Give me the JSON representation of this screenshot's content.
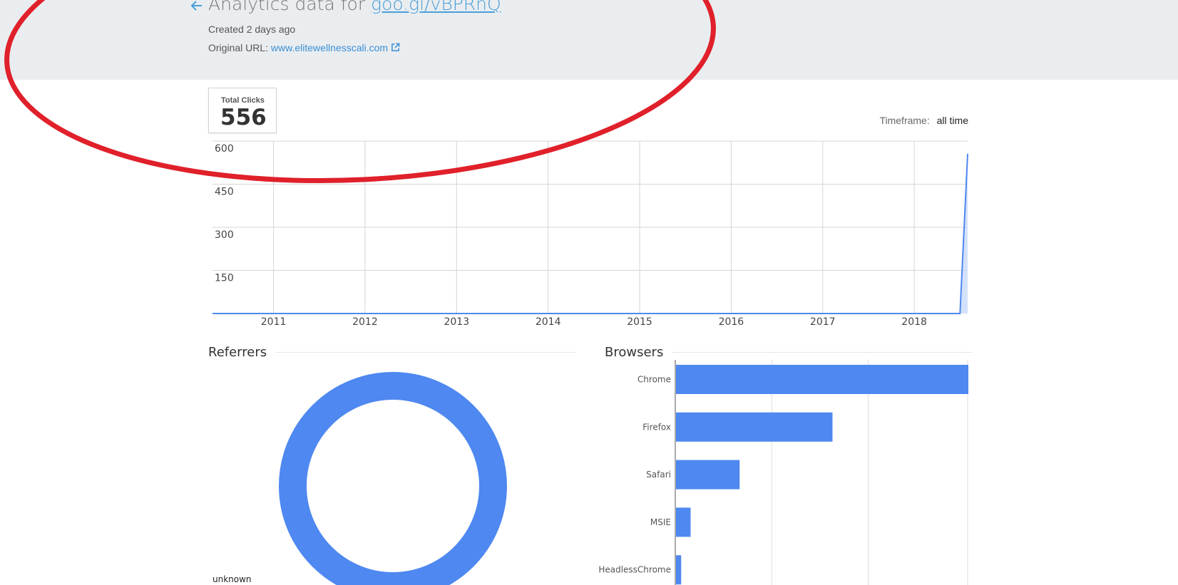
{
  "header": {
    "title_prefix": "Analytics data for",
    "short_url": "goo.gl/vBPRnQ",
    "created": "Created 2 days ago",
    "original_url_label": "Original URL:",
    "original_url": "www.elitewellnesscali.com"
  },
  "stats": {
    "total_clicks_label": "Total Clicks",
    "total_clicks_value": "556",
    "timeframe_label": "Timeframe:",
    "timeframe_value": "all time"
  },
  "referrers": {
    "title": "Referrers",
    "legend_label": "unknown"
  },
  "browsers": {
    "title": "Browsers"
  },
  "colors": {
    "accent": "#4e88f0",
    "link": "#4a9ed8",
    "annotation": "#e0202a",
    "header_bg": "#eaedf0"
  },
  "icons": {
    "back": "arrow-left-icon",
    "external": "external-link-icon"
  },
  "chart_data": [
    {
      "type": "area",
      "title": "",
      "xlabel": "",
      "ylabel": "",
      "x_ticks": [
        "2011",
        "2012",
        "2013",
        "2014",
        "2015",
        "2016",
        "2017",
        "2018"
      ],
      "y_ticks": [
        150,
        300,
        450,
        600
      ],
      "ylim": [
        0,
        600
      ],
      "xlim": [
        "2010-05",
        "2018-08"
      ],
      "x": [
        "2010-05",
        "2018-07",
        "2018-08"
      ],
      "series": [
        {
          "values": [
            0,
            0,
            556
          ]
        }
      ],
      "grid": true
    },
    {
      "type": "pie",
      "title": "Referrers",
      "donut": true,
      "categories": [
        "unknown"
      ],
      "values": [
        556
      ]
    },
    {
      "type": "bar",
      "orientation": "horizontal",
      "title": "Browsers",
      "categories": [
        "Chrome",
        "Firefox",
        "Safari",
        "MSIE",
        "HeadlessChrome"
      ],
      "values": [
        340,
        182,
        74,
        17,
        6
      ],
      "xlim": [
        0,
        340
      ],
      "grid": true
    }
  ]
}
